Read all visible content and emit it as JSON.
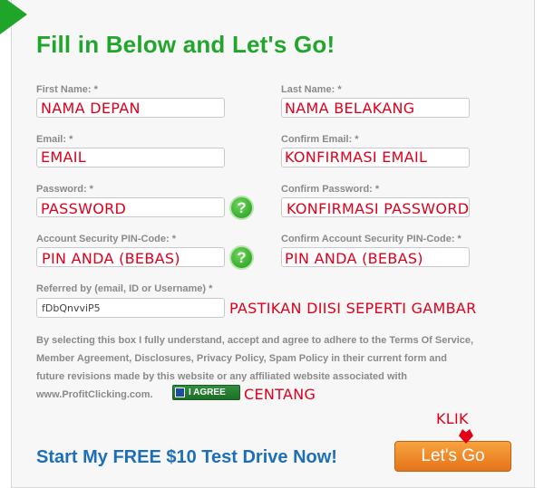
{
  "form": {
    "title": "Fill in Below and Let's Go!",
    "fields": {
      "first_name": {
        "label": "First Name: *",
        "annotation": "NAMA DEPAN"
      },
      "last_name": {
        "label": "Last Name: *",
        "annotation": "NAMA BELAKANG"
      },
      "email": {
        "label": "Email: *",
        "annotation": "EMAIL"
      },
      "confirm_email": {
        "label": "Confirm Email: *",
        "annotation": "KONFIRMASI EMAIL"
      },
      "password": {
        "label": "Password: *",
        "annotation": "PASSWORD"
      },
      "confirm_password": {
        "label": "Confirm Password: *",
        "annotation": "KONFIRMASI PASSWORD"
      },
      "pin": {
        "label": "Account Security PIN-Code: *",
        "annotation": "PIN ANDA (BEBAS)"
      },
      "confirm_pin": {
        "label": "Confirm Account Security PIN-Code: *",
        "annotation": "PIN ANDA (BEBAS)"
      },
      "referred": {
        "label": "Referred by (email, ID or Username) *",
        "value": "fDbQnvviP5",
        "annotation": "PASTIKAN DIISI SEPERTI  GAMBAR"
      }
    },
    "help_glyph": "?",
    "terms_lines": [
      "By selecting this box I fully understand, accept and agree to adhere to the Terms Of Service,",
      "Member Agreement, Disclosures, Privacy Policy, Spam Policy in their current form and",
      "future revisions made by this website or any affiliated website associated with",
      "www.ProfitClicking.com."
    ],
    "agree_label": "I AGREE",
    "agree_annotation": "CENTANG",
    "cta_text": "Start My FREE $10 Test Drive Now!",
    "submit_label": "Let's Go",
    "submit_annotation": "KLIK",
    "colors": {
      "title": "#22a52c",
      "annotation": "#e0001b",
      "cta": "#1d6fb8",
      "button": "#f08a2a"
    }
  }
}
